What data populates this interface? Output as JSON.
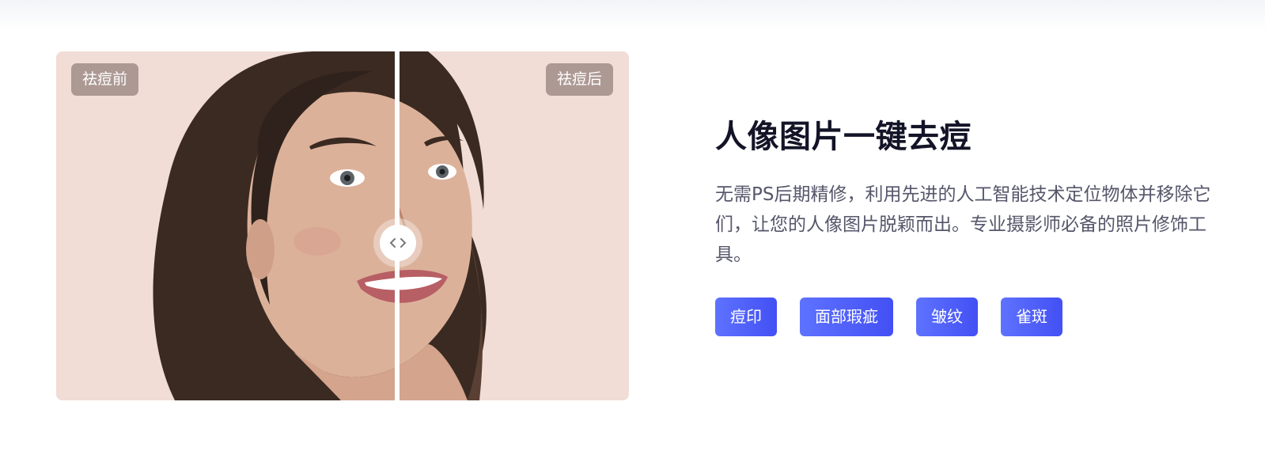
{
  "comparison": {
    "before_label": "祛痘前",
    "after_label": "祛痘后",
    "handle_icon": "chevron-left-right-icon",
    "split_position": 0.6,
    "image_subject": "portrait"
  },
  "feature": {
    "title": "人像图片一键去痘",
    "description": "无需PS后期精修，利用先进的人工智能技术定位物体并移除它们，让您的人像图片脱颖而出。专业摄影师必备的照片修饰工具。",
    "tags": [
      "痘印",
      "面部瑕疵",
      "皱纹",
      "雀斑"
    ]
  },
  "colors": {
    "accent": "#4d5cf8",
    "title": "#141428",
    "text": "#55566a",
    "photo_bg": "#f1ddd6"
  }
}
